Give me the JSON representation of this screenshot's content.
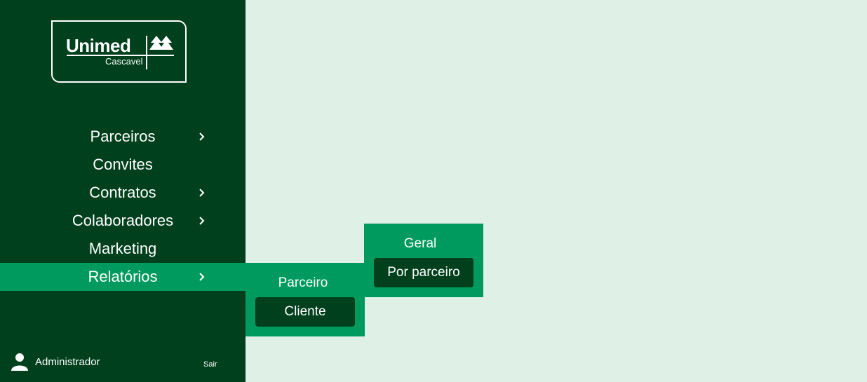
{
  "logo": {
    "brand": "Unimed",
    "city": "Cascavel"
  },
  "menu": {
    "items": [
      {
        "label": "Parceiros",
        "has_submenu": true
      },
      {
        "label": "Convites",
        "has_submenu": false
      },
      {
        "label": "Contratos",
        "has_submenu": true
      },
      {
        "label": "Colaboradores",
        "has_submenu": true
      },
      {
        "label": "Marketing",
        "has_submenu": false
      },
      {
        "label": "Relatórios",
        "has_submenu": true,
        "active": true
      }
    ]
  },
  "submenu_relatorios": {
    "items": [
      "Parceiro",
      "Cliente"
    ],
    "selected": "Cliente"
  },
  "submenu_parceiro": {
    "items": [
      "Geral",
      "Por parceiro"
    ],
    "selected": "Por parceiro"
  },
  "user": {
    "name": "Administrador",
    "icon": "user-icon",
    "logout_label": "Sair"
  },
  "colors": {
    "sidebar": "#00401c",
    "accent": "#009a5e",
    "background": "#dff0e7"
  }
}
